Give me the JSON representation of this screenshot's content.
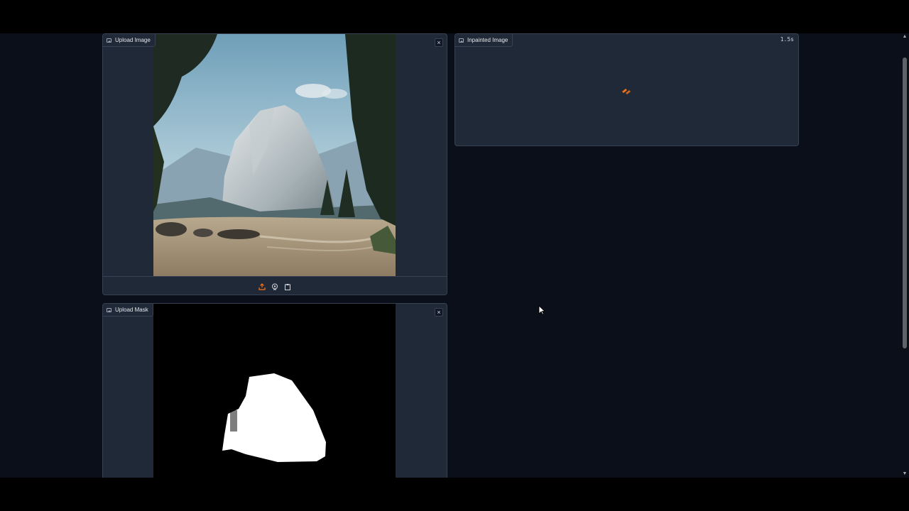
{
  "upload_image": {
    "label": "Upload Image",
    "close_symbol": "×",
    "tools": [
      "upload-icon",
      "webcam-icon",
      "clipboard-icon"
    ]
  },
  "upload_mask": {
    "label": "Upload Mask",
    "close_symbol": "×"
  },
  "inpainted_image": {
    "label": "Inpainted Image",
    "timer": "1.5s",
    "status_icon": "loading-spinner-icon"
  },
  "colors": {
    "accent": "#f97316",
    "panel_bg": "#1f2937",
    "page_bg": "#0b0f19"
  }
}
